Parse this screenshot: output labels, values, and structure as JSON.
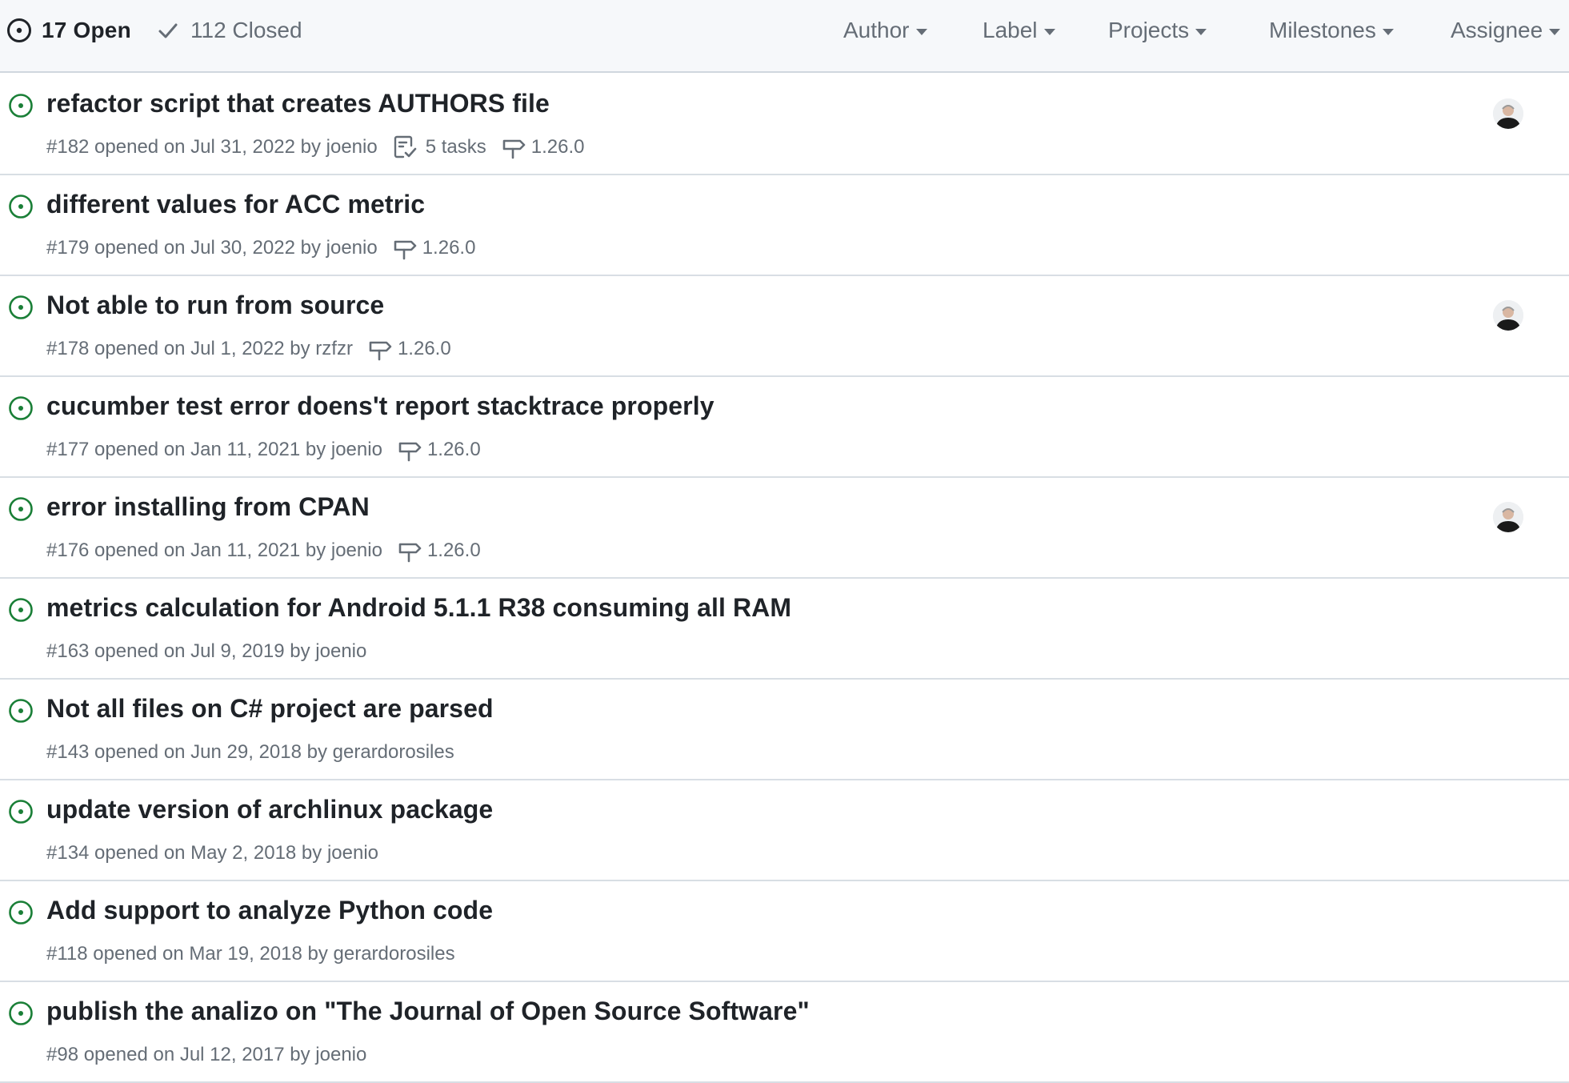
{
  "header": {
    "open_count_label": "17 Open",
    "closed_count_label": "112 Closed",
    "filters": [
      "Author",
      "Label",
      "Projects",
      "Milestones",
      "Assignee"
    ]
  },
  "colors": {
    "open_green": "#1a7f37",
    "muted": "#656d76",
    "text": "#1f2328",
    "border": "#d0d7de"
  },
  "icons": {
    "open_issue": "issue-opened-icon",
    "closed": "check-icon",
    "tasks": "checklist-icon",
    "milestone": "milestone-icon",
    "dropdown": "triangle-down-icon"
  },
  "issues": [
    {
      "title": "refactor script that creates AUTHORS file",
      "number_opened": "#182 opened on Jul 31, 2022 by",
      "author": "joenio",
      "tasks": "5 tasks",
      "milestone": "1.26.0",
      "assigned": true
    },
    {
      "title": "different values for ACC metric",
      "number_opened": "#179 opened on Jul 30, 2022 by",
      "author": "joenio",
      "tasks": "",
      "milestone": "1.26.0",
      "assigned": false
    },
    {
      "title": "Not able to run from source",
      "number_opened": "#178 opened on Jul 1, 2022 by",
      "author": "rzfzr",
      "tasks": "",
      "milestone": "1.26.0",
      "assigned": true
    },
    {
      "title": "cucumber test error doens't report stacktrace properly",
      "number_opened": "#177 opened on Jan 11, 2021 by",
      "author": "joenio",
      "tasks": "",
      "milestone": "1.26.0",
      "assigned": false
    },
    {
      "title": "error installing from CPAN",
      "number_opened": "#176 opened on Jan 11, 2021 by",
      "author": "joenio",
      "tasks": "",
      "milestone": "1.26.0",
      "assigned": true
    },
    {
      "title": "metrics calculation for Android 5.1.1 R38 consuming all RAM",
      "number_opened": "#163 opened on Jul 9, 2019 by",
      "author": "joenio",
      "tasks": "",
      "milestone": "",
      "assigned": false
    },
    {
      "title": "Not all files on C# project are parsed",
      "number_opened": "#143 opened on Jun 29, 2018 by",
      "author": "gerardorosiles",
      "tasks": "",
      "milestone": "",
      "assigned": false
    },
    {
      "title": "update version of archlinux package",
      "number_opened": "#134 opened on May 2, 2018 by",
      "author": "joenio",
      "tasks": "",
      "milestone": "",
      "assigned": false
    },
    {
      "title": "Add support to analyze Python code",
      "number_opened": "#118 opened on Mar 19, 2018 by",
      "author": "gerardorosiles",
      "tasks": "",
      "milestone": "",
      "assigned": false
    },
    {
      "title": "publish the analizo on \"The Journal of Open Source Software\"",
      "number_opened": "#98 opened on Jul 12, 2017 by",
      "author": "joenio",
      "tasks": "",
      "milestone": "",
      "assigned": false
    }
  ]
}
